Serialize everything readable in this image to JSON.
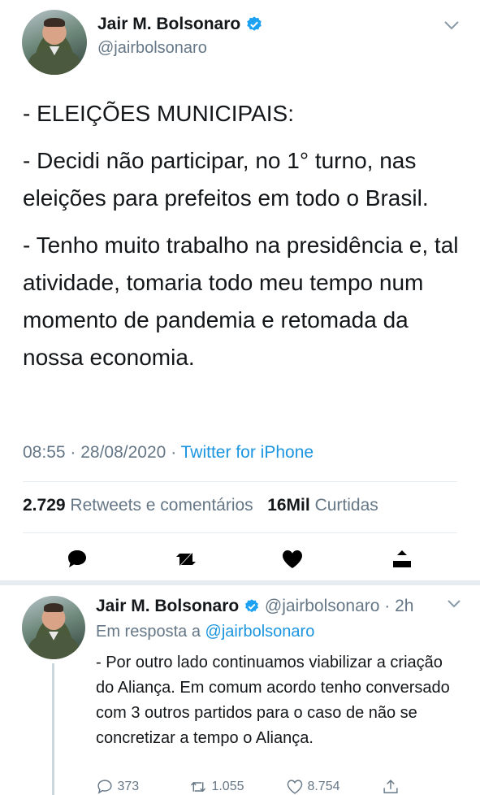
{
  "tweet": {
    "name": "Jair M. Bolsonaro",
    "handle": "@jairbolsonaro",
    "body": [
      "- ELEIÇÕES MUNICIPAIS:",
      "- Decidi não participar, no 1° turno, nas eleições para prefeitos em todo o Brasil.",
      "- Tenho muito trabalho na presidência e, tal atividade, tomaria todo meu tempo num momento de pandemia e retomada da nossa economia."
    ],
    "time": "08:55",
    "date": "28/08/2020",
    "source": "Twitter for iPhone",
    "retweets_count": "2.729",
    "retweets_label": "Retweets e comentários",
    "likes_count": "16Mil",
    "likes_label": "Curtidas",
    "dot": "·"
  },
  "reply": {
    "name": "Jair M. Bolsonaro",
    "handle": "@jairbolsonaro",
    "time_ago": "2h",
    "reply_prefix": "Em resposta a",
    "reply_handle": "@jairbolsonaro",
    "body": "- Por outro lado continuamos viabilizar a criação do Aliança. Em comum acordo tenho conversado com 3 outros partidos para o caso de não se concretizar a tempo o Aliança.",
    "replies_count": "373",
    "retweets_count": "1.055",
    "likes_count": "8.754"
  },
  "icons": {
    "verified": "verified-badge-icon",
    "chevron": "chevron-down-icon",
    "reply": "reply-icon",
    "retweet": "retweet-icon",
    "like": "heart-icon",
    "share": "share-icon"
  },
  "colors": {
    "link": "#1b95e0",
    "secondary": "#657786",
    "verified": "#1da1f2"
  }
}
